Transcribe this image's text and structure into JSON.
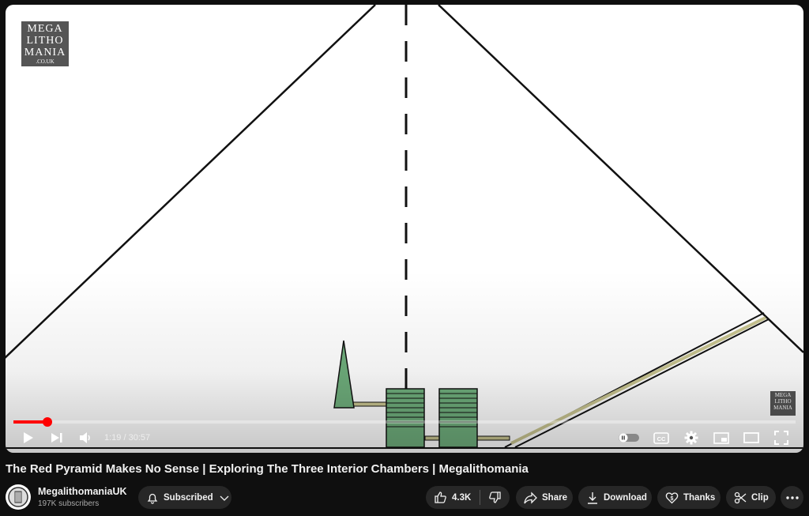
{
  "video": {
    "watermark_lines": [
      "MEGA",
      "LITHO",
      "MANIA",
      ".CO.UK"
    ],
    "current_time": "1:19",
    "duration": "30:57",
    "time_display": "1:19 / 30:57",
    "progress_fraction": 0.043
  },
  "title": "The Red Pyramid Makes No Sense | Exploring The Three Interior Chambers | Megalithomania",
  "channel": {
    "name": "MegalithomaniaUK",
    "subscribers": "197K subscribers",
    "subscribe_label": "Subscribed"
  },
  "actions": {
    "likes": "4.3K",
    "share": "Share",
    "download": "Download",
    "thanks": "Thanks",
    "clip": "Clip"
  },
  "colors": {
    "accent": "#ff0000",
    "background": "#0f0f0f",
    "pill": "#272727",
    "chamber_green": "#6fae7c"
  }
}
